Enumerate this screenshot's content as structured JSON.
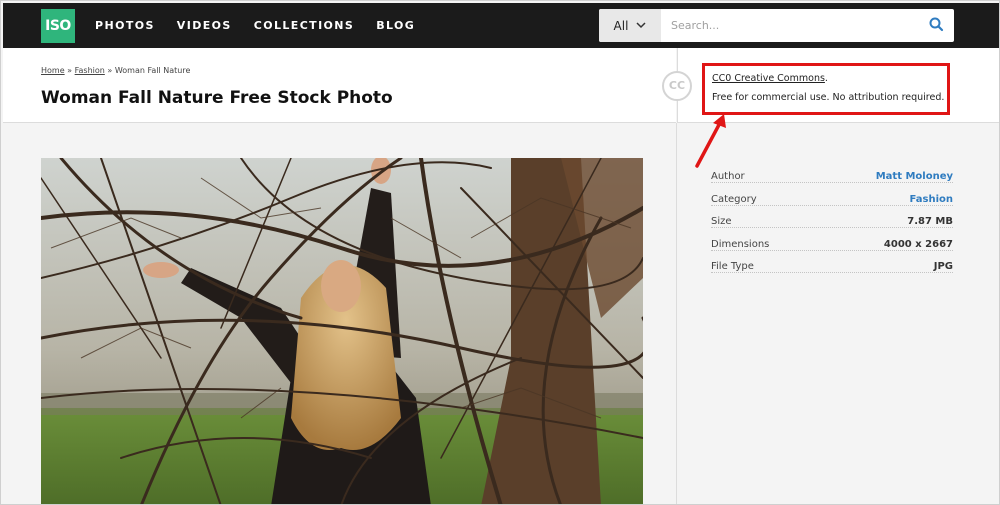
{
  "nav": {
    "logo": "ISO",
    "items": [
      "PHOTOS",
      "VIDEOS",
      "COLLECTIONS",
      "BLOG"
    ],
    "search_select": "All",
    "search_placeholder": "Search..."
  },
  "breadcrumb": {
    "home": "Home",
    "sep1": "»",
    "category": "Fashion",
    "sep2": "»",
    "current": "Woman Fall Nature"
  },
  "page_title": "Woman Fall Nature Free Stock Photo",
  "license": {
    "badge": "CC",
    "link": "CC0 Creative Commons",
    "link_suffix": ".",
    "note": "Free for commercial use. No attribution required."
  },
  "details": [
    {
      "key": "Author",
      "value": "Matt Moloney",
      "link": true
    },
    {
      "key": "Category",
      "value": "Fashion",
      "link": true
    },
    {
      "key": "Size",
      "value": "7.87 MB",
      "link": false
    },
    {
      "key": "Dimensions",
      "value": "4000 x 2667",
      "link": false
    },
    {
      "key": "File Type",
      "value": "JPG",
      "link": false
    }
  ],
  "colors": {
    "brand": "#2fb57c",
    "nav_bg": "#1b1b1b",
    "link": "#2f7cc0",
    "highlight": "#e01616"
  }
}
